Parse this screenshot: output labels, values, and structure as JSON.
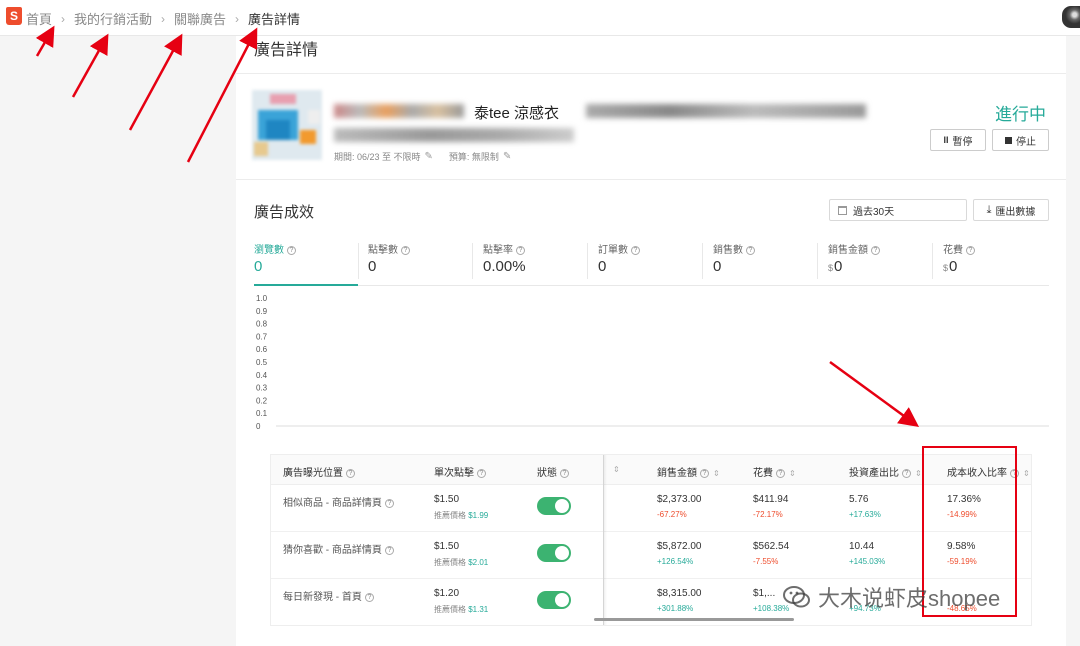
{
  "breadcrumb": {
    "logo": "S",
    "items": [
      "首頁",
      "我的行銷活動",
      "關聯廣告",
      "廣告詳情"
    ]
  },
  "page": {
    "title": "廣告詳情"
  },
  "ad": {
    "name_partial": "泰tee 涼感衣",
    "meta_period": "期間: 06/23 至 不限時",
    "meta_budget": "預算: 無限制",
    "status": "進行中",
    "pause_label": "暫停",
    "stop_label": "停止"
  },
  "performance": {
    "title": "廣告成效",
    "date_range": "過去30天",
    "export_label": "匯出數據",
    "metrics": [
      {
        "label": "瀏覽數",
        "value": "0",
        "currency": ""
      },
      {
        "label": "點擊數",
        "value": "0",
        "currency": ""
      },
      {
        "label": "點擊率",
        "value": "0.00%",
        "currency": ""
      },
      {
        "label": "訂單數",
        "value": "0",
        "currency": ""
      },
      {
        "label": "銷售數",
        "value": "0",
        "currency": ""
      },
      {
        "label": "銷售金額",
        "value": "0",
        "currency": "$"
      },
      {
        "label": "花費",
        "value": "0",
        "currency": "$"
      }
    ]
  },
  "chart_data": {
    "type": "line",
    "title": "",
    "xlabel": "",
    "ylabel": "",
    "yticks": [
      "1.0",
      "0.9",
      "0.8",
      "0.7",
      "0.6",
      "0.5",
      "0.4",
      "0.3",
      "0.2",
      "0.1",
      "0"
    ],
    "ylim": [
      0,
      1.0
    ],
    "series": []
  },
  "table": {
    "headers": {
      "position": "廣告曝光位置",
      "bid": "單次點擊",
      "status": "狀態",
      "sales": "銷售金額",
      "cost": "花費",
      "roi": "投資產出比",
      "acos": "成本收入比率"
    },
    "rows": [
      {
        "position": "相似商品 - 商品詳情頁",
        "bid": "$1.50",
        "suggest_label": "推薦價格",
        "suggest": "$1.99",
        "sales": "$2,373.00",
        "sales_change": "-67.27%",
        "cost": "$411.94",
        "cost_change": "-72.17%",
        "roi": "5.76",
        "roi_change": "+17.63%",
        "acos": "17.36%",
        "acos_change": "-14.99%"
      },
      {
        "position": "猜你喜歡 - 商品詳情頁",
        "bid": "$1.50",
        "suggest_label": "推薦價格",
        "suggest": "$2.01",
        "sales": "$5,872.00",
        "sales_change": "+126.54%",
        "cost": "$562.54",
        "cost_change": "-7.55%",
        "roi": "10.44",
        "roi_change": "+145.03%",
        "acos": "9.58%",
        "acos_change": "-59.19%"
      },
      {
        "position": "每日新發現 - 首頁",
        "bid": "$1.20",
        "suggest_label": "推薦價格",
        "suggest": "$1.31",
        "sales": "$8,315.00",
        "sales_change": "+301.88%",
        "cost": "$1,...",
        "cost_change": "+108.38%",
        "roi": "",
        "roi_change": "+94.73%",
        "acos": "",
        "acos_change": "-48.65%"
      }
    ]
  },
  "watermark": {
    "text": "大木说虾皮shopee"
  },
  "colors": {
    "brand": "#ee4d2d",
    "accent": "#26aa99",
    "annotation": "#e60012"
  }
}
